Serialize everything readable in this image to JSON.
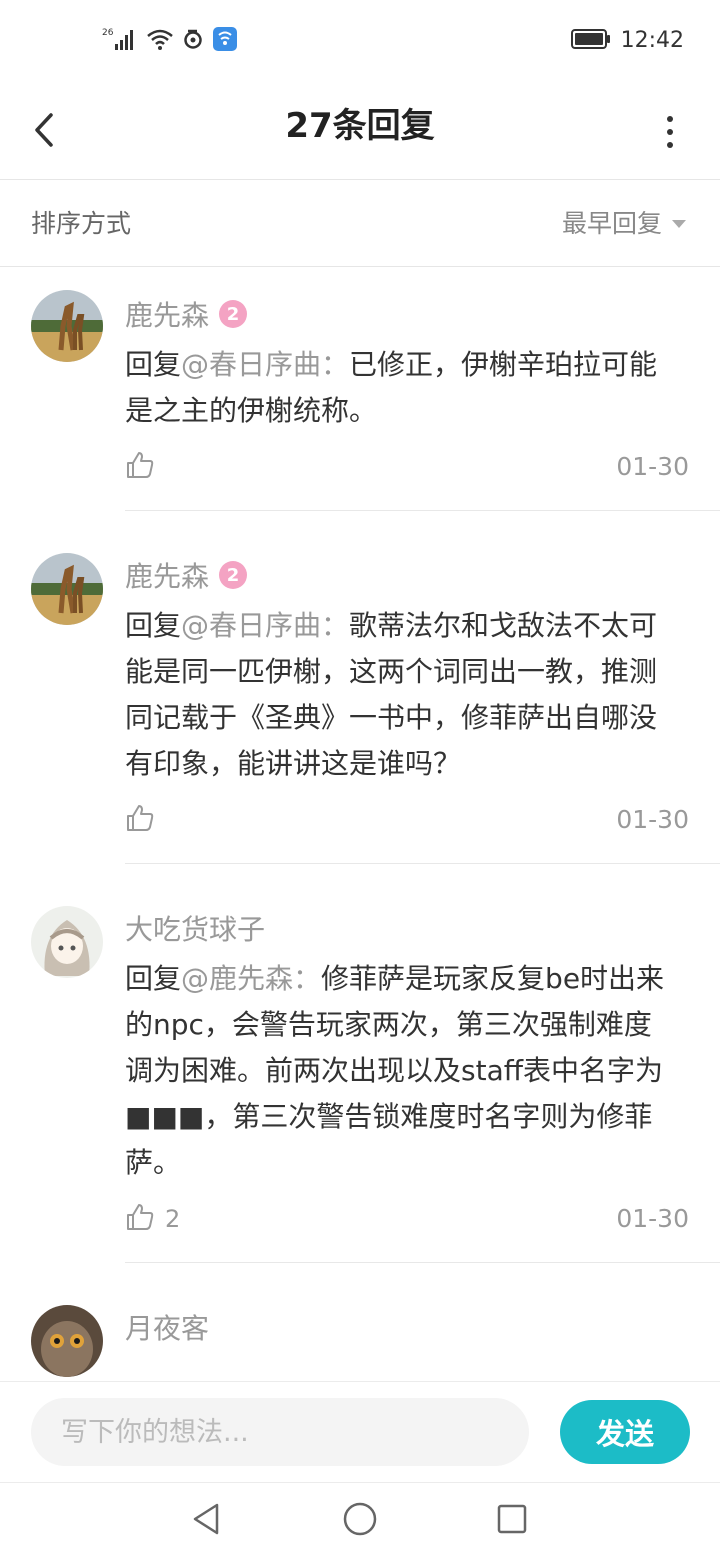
{
  "status_bar": {
    "network": "26",
    "time": "12:42",
    "icons": [
      "signal-icon",
      "wifi-icon",
      "sync-icon",
      "app-notification-icon",
      "battery-icon"
    ]
  },
  "header": {
    "title": "27条回复",
    "icons": [
      "back-arrow-icon",
      "more-vertical-icon"
    ]
  },
  "sort": {
    "label": "排序方式",
    "value": "最早回复"
  },
  "comments": [
    {
      "name": "鹿先森",
      "badge": "2",
      "prefix": "回复",
      "mention": "@春日序曲",
      "separator": "：",
      "text": "已修正，伊榭辛珀拉可能是之主的伊榭统称。",
      "likes": "",
      "date": "01-30"
    },
    {
      "name": "鹿先森",
      "badge": "2",
      "prefix": "回复",
      "mention": "@春日序曲",
      "separator": "：",
      "text": "歌蒂法尔和戈敌法不太可能是同一匹伊榭，这两个词同出一教，推测同记载于《圣典》一书中，修菲萨出自哪没有印象，能讲讲这是谁吗？",
      "likes": "",
      "date": "01-30"
    },
    {
      "name": "大吃货球子",
      "badge": "",
      "prefix": "回复",
      "mention": "@鹿先森",
      "separator": "：",
      "text": "修菲萨是玩家反复be时出来的npc，会警告玩家两次，第三次强制难度调为困难。前两次出现以及staff表中名字为■■■，第三次警告锁难度时名字则为修菲萨。",
      "likes": "2",
      "date": "01-30"
    },
    {
      "name": "月夜客",
      "badge": "",
      "prefix": "",
      "mention": "",
      "separator": "",
      "text": "",
      "likes": "",
      "date": ""
    }
  ],
  "input": {
    "placeholder": "写下你的想法...",
    "send_label": "发送"
  },
  "colors": {
    "accent": "#1cbcc7",
    "badge": "#f4a3c3",
    "muted_text": "#999999",
    "body_text": "#333333"
  }
}
